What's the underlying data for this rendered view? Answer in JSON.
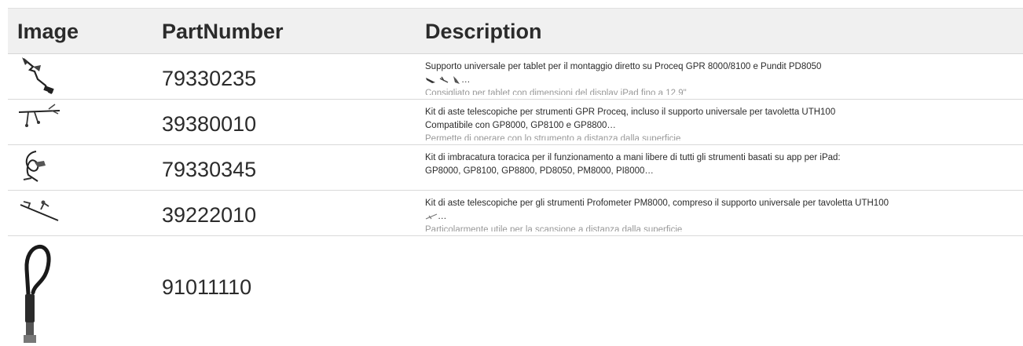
{
  "table": {
    "headers": {
      "image": "Image",
      "part_number": "PartNumber",
      "description": "Description"
    },
    "rows": [
      {
        "part_number": "79330235",
        "description_line1": "Supporto universale per tablet per il montaggio diretto su Proceq GPR 8000/8100 e Pundit PD8050",
        "description_line2_suffix": "…",
        "description_line3": "Consigliato per tablet con dimensioni del display iPad fino a 12.9\"",
        "image_icon": "tablet-holder-icon"
      },
      {
        "part_number": "39380010",
        "description_line1": "Kit di aste telescopiche per strumenti GPR Proceq, incluso il supporto universale per tavoletta UTH100",
        "description_line2": "Compatibile con GP8000, GP8100 e GP8800…",
        "description_line3": "Permette di operare con lo strumento a distanza dalla superficie",
        "image_icon": "telescopic-rod-icon"
      },
      {
        "part_number": "79330345",
        "description_line1": "Kit di imbracatura toracica per il funzionamento a mani libere di tutti gli strumenti basati su app per iPad:",
        "description_line2": "GP8000, GP8100, GP8800, PD8050, PM8000, PI8000…",
        "image_icon": "chest-harness-icon"
      },
      {
        "part_number": "39222010",
        "description_line1": "Kit di aste telescopiche per gli strumenti Profometer PM8000, compreso il supporto universale per tavoletta UTH100",
        "description_line2_suffix": "…",
        "description_line3": "Particolarmente utile per la scansione a distanza dalla superficie",
        "image_icon": "telescopic-rod-icon"
      },
      {
        "part_number": "91011110",
        "image_icon": "cable-lock-icon"
      }
    ]
  }
}
